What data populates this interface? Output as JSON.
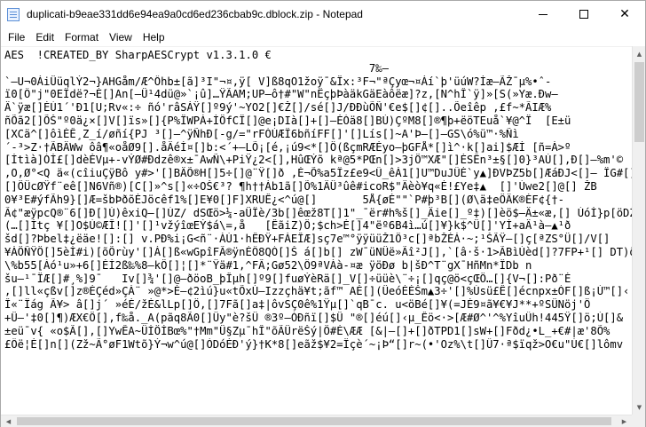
{
  "window": {
    "title": "duplicati-b9eae331dd6e94ea9a0cd6ed236cbab9c.dblock.zip - Notepad",
    "icon": "notepad-icon",
    "buttons": {
      "minimize": "minimize-icon",
      "maximize": "maximize-icon",
      "close": "close-icon",
      "close_glyph": "✕"
    }
  },
  "menu": {
    "items": [
      "File",
      "Edit",
      "Format",
      "View",
      "Help"
    ]
  },
  "editor": {
    "lines": [
      "AES  !CREATED_BY SharpAESCrypt v1.3.1.0 €",
      "                                                        7‰–",
      "`–U¬0ÁiÜüqlÝ2¬}AHGåm/Æ^Ôhb±[ã]³I\"¬¤,ÿ[ V]ß8qO1žoÿ¯&Ïx:³F¬\"ªÇyœ¬¤Áí`þ'üúW?Íæ–ÃŽ¯µ%•ˆ-",
      "ï0[Ô\"j\"0EÏdë?¬È[]An[–Ü¹4dü@»`¡û]…ŸÃAM;UP–ô†#\"W\"nËçþÞàäkGäEàôëæ]?z,[N^hÎ`ÿ]»[S(»Yæ.Ðw–",
      "Ä`ÿæ[]ÉÙ1´'Ð1[U;Rv«:÷ ñó'râSÁŸ[]º9ý'~YO2[]€Ž[]/sé[]J/ÐÐùÕÑ'€e$[]¢[]..Õeîêp ,£f~*ÃIÆ%",
      "ñÕã2[]ÕŠ\"º0ä¿×[]V[]ïs»[]{P%ÏWPÁ+ÌÖfCÏ[]@e¡DIà[]+[]–ÉÓä8[]BÙ)ÇºM8[]®¶þ+ëöTEuå`¥@^Ï  [E±ü",
      "[XCä^[]ôìÈÊ¸Z_í/øñí{PJ ³[]–^ÿÑhÐ[-g/=\"rFÓÚÆÏ6bñíFF[]'[]Lís[]~A'Þ–[]–GS\\ó%ü™·%Ñì",
      "´-³>Z·†ÃBÄWw ôâ¶«oåØ9[].åÄéÌ¤[]b:<´+—LÕ¡[é,¡ú9<*[]Ö(ßçmRÆÉyo–þGFÅ*[]ì^·k[]ai]$ÆÍ [ñ=À>º",
      "[Ìtìà]ÓÌ£[]dèÉVµ+-vÝØ#Ðdzê®x±¯AwÑ\\+PiŸ¿2<[],HûŒÝõ kª@5*PŒn[]>3jÖ™XÆ\"[]ÈSÊn³±§[]0}³AÙ[],Ð[]–%m'©",
      ",O,Ø°<Q ä«(cîiuÇÿBô y#>'[]BÄÕ®H[]5÷[]@¨Ÿ[]ð ,É¬Õ%a5Ïz£e9<Û_êÁ1[]U™DuJÛÈ`y▲]ÐVÞZ5b[]ÆáÐJ<[]– ÏG#[]",
      "[]ÖÜcØŸf¨eê[]N6Vñ®)[C[]»^s[]«÷OŠ€³? ¶h††Áb1ã[]Õ%1ÄÜ³ûê#icoR$\"Äèò¥q«É!£Ye‡▲  []'Úwe2[]@[] ŽB",
      "0¥³E#ýfÃh9}[]Æ=šbÞðõÈJöcêf1%[]E¥0[]F]XRUÊ¿<^ú@[]       5Å{øÉ\"\"`P#þ³B[](Ø\\ä‡eÖÄK®ÈF¢{†-",
      "Ã¢\"æÿpcQ®¨6[]Ð[]Ú)êxiQ–[]ÚZ/ dSŒö>¼-aÜÏè/3b[]êœž8T[]1\"_¯ër#h%š[]_Äie[]_º‡)[]èö$–Ä±«æ,[] ÚóÌ}p[öDŽh6pç",
      "(…[]Ìtç ¥[]O$Ù©ÆÎ![]'[]¹vžýîœEÝ$á\\=,å   [ÊãiZ)Ö;$ch>È[]4\"ëº6B4ì…ú[]¥}k$^Ü[]'YÌ+aÄ¹à–▲¹ð",
      "šd[]?Þbel‡¿ëäe![]:[] v.PÐ%i¡G<ñ¨·ÀÚ1·hÊÐŸ+FÀEÎÆ]sç7e™°ÿÿüüŽ1Ö³c[]ªbŽÈÁ·~;¹ŠÃŸ–[]ç[ªZS°Ü[]/V[]",
      "¥ÀÖÑŸÖ[]5èÌ#i)[õÕrùy'[]Á[]ß«wGpîFÃ®ÿnÉÔ8QÓ[]Š á[]b[] zW¯üNÜë»Ãî²J[],`[â·š·1>ÃBìÙèd[]?7FP+¹[] DT)ðÙÖ[]",
      "\\%b55[Áó¹u»+6[]ÉÍ2ß‰%8–kÖ[]¦[]*¨Ÿä#1,^FÃ;Gø52\\Ö9ªVÀà-¤æ ÿöÐø b|šÐ^T¨gX¯HñMn*ÏDb n",
      "šu–¹¯ÏÆ[]#¸%]9¯   Iv[]¾'[]@–ðöoB_þÎµh[]º9[]fuøÝèRä[]_V[]÷üüè\\¨÷¡[]qç@ö<çŒÖ…[]{V¬[]:Pð¨È",
      ",[]ll«çßv[]z®ÉÇéd»ÇÀ¨ »@*>È–¢2ìú}u«tÕxÚ–Izzçhä¥t;ãf™ AÉ[](ÜeóÉÉŠm▲3÷'[]%Úsü£Ê[]écnpx±ÒF[]ß¡Ú™[]‹",
      "Î«¨Ïág Ã¥> â[]j´ »éÉ/žÉ&lLp[]Ö,[]7Fã[]a‡|ôvSÇ0ê%1Ÿµ[]`qB¯c. u<öBé[]¥(=JÉ9¤ã¥€¥J**+ºSÜNöj'Ö",
      "+Ü–'‡0[]¶)ÆX€Ö[],f‰å._A(pãq8Ã0[]Üy\"è?šÜ ®3º–ÓÐñï[]$Ü \"®[]éú[]‹µ_Êö<·>[Æ#Ø^'^%YîuÛh!445Ÿ[]ö;Ú[]&",
      "±eü¯v{ «o$Ã[],[]YwÊA~ÜÌÖÍBœ%\"†Mm\"Ü§Zµ¯hÎ\"õÃÜrëŠý|Ö#É\\ÆÆ [&|–[]+[]ðTPD1[]sW+[]Fðd¿•L_+€#|æ'8Õ%",
      "£Ôë¦È[]n[](Zž~Ã°øF1Wtõ}Ý¬w^ú@[]ÒDóÉÐ'ý}†K*8[]eãž$¥2=Ïçè´~¡Þ“[]r~(•'Oz%\\t[]Û7·ª$ïqž>O€u\"Ú€[]lômv"
    ]
  },
  "scrollbars": {
    "up_arrow": "▲",
    "down_arrow": "▼",
    "left_arrow": "◀",
    "right_arrow": "▶"
  }
}
